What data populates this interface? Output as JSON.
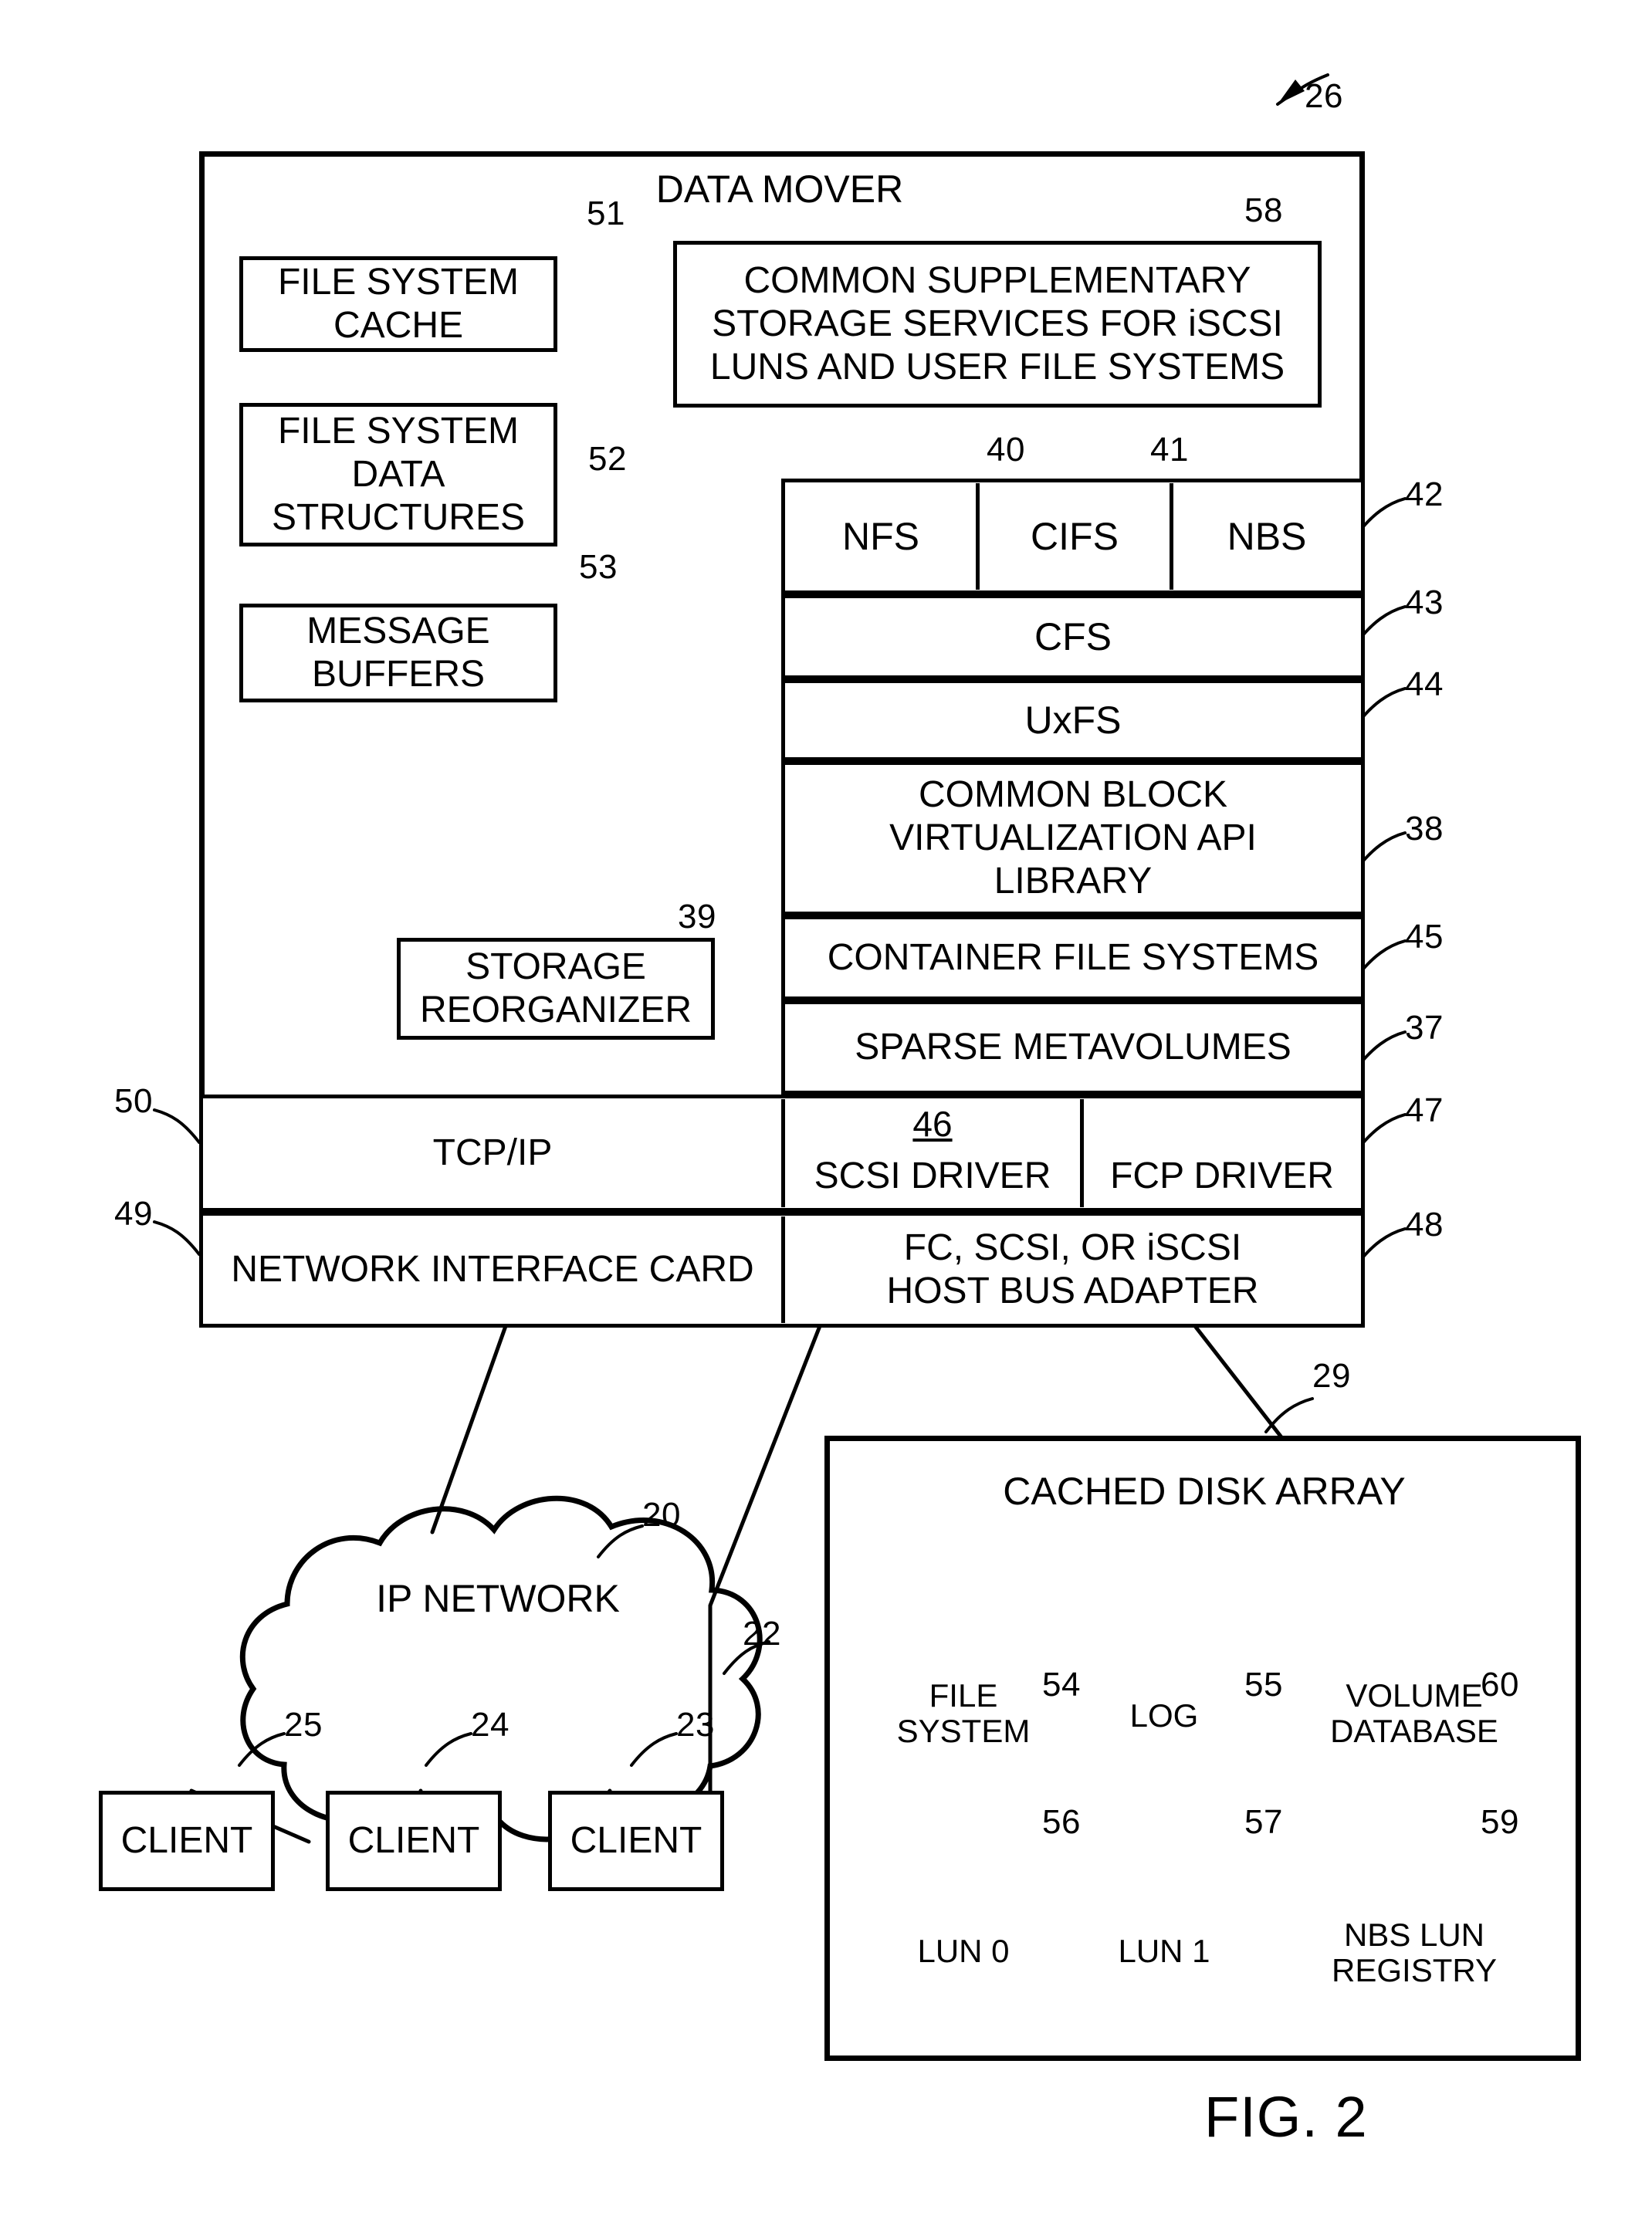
{
  "figure": {
    "label": "FIG. 2"
  },
  "data_mover": {
    "title": "DATA MOVER",
    "ref": "26",
    "left_boxes": [
      {
        "label": "FILE SYSTEM\nCACHE",
        "ref": "51"
      },
      {
        "label": "FILE SYSTEM\nDATA\nSTRUCTURES",
        "ref": "52"
      },
      {
        "label": "MESSAGE\nBUFFERS",
        "ref": "53"
      },
      {
        "label": "STORAGE\nREORGANIZER",
        "ref": "39"
      }
    ],
    "supplementary": {
      "label": "COMMON SUPPLEMENTARY\nSTORAGE SERVICES FOR  iSCSI\nLUNS AND USER FILE SYSTEMS",
      "ref": "58"
    },
    "protocols": [
      {
        "label": "NFS",
        "ref": "40"
      },
      {
        "label": "CIFS",
        "ref": "41"
      },
      {
        "label": "NBS",
        "ref": "42"
      }
    ],
    "stack": [
      {
        "label": "CFS",
        "ref": "43"
      },
      {
        "label": "UxFS",
        "ref": "44"
      },
      {
        "label": "COMMON BLOCK\nVIRTUALIZATION API\nLIBRARY",
        "ref": "38"
      },
      {
        "label": "CONTAINER FILE SYSTEMS",
        "ref": "45"
      },
      {
        "label": "SPARSE METAVOLUMES",
        "ref": "37"
      }
    ],
    "driver_row": {
      "tcpip": {
        "label": "TCP/IP",
        "ref": "50"
      },
      "scsi": {
        "label": "SCSI DRIVER",
        "ref": "46"
      },
      "fcp": {
        "label": "FCP DRIVER",
        "ref": "47"
      }
    },
    "adapter_row": {
      "nic": {
        "label": "NETWORK INTERFACE CARD",
        "ref": "49"
      },
      "hba": {
        "label": "FC, SCSI, OR iSCSI\nHOST BUS ADAPTER",
        "ref": "48"
      }
    }
  },
  "network": {
    "cloud_label": "IP NETWORK",
    "cloud_ref": "20",
    "link_ref": "22",
    "clients": [
      {
        "label": "CLIENT",
        "ref": "25"
      },
      {
        "label": "CLIENT",
        "ref": "24"
      },
      {
        "label": "CLIENT",
        "ref": "23"
      }
    ]
  },
  "disk_array": {
    "title": "CACHED DISK ARRAY",
    "ref": "29",
    "cylinders": [
      {
        "label": "FILE\nSYSTEM",
        "ref": "54"
      },
      {
        "label": "LOG",
        "ref": "55"
      },
      {
        "label": "VOLUME\nDATABASE",
        "ref": "60"
      },
      {
        "label": "LUN 0",
        "ref": "56"
      },
      {
        "label": "LUN 1",
        "ref": "57"
      },
      {
        "label": "NBS LUN\nREGISTRY",
        "ref": "59"
      }
    ]
  }
}
